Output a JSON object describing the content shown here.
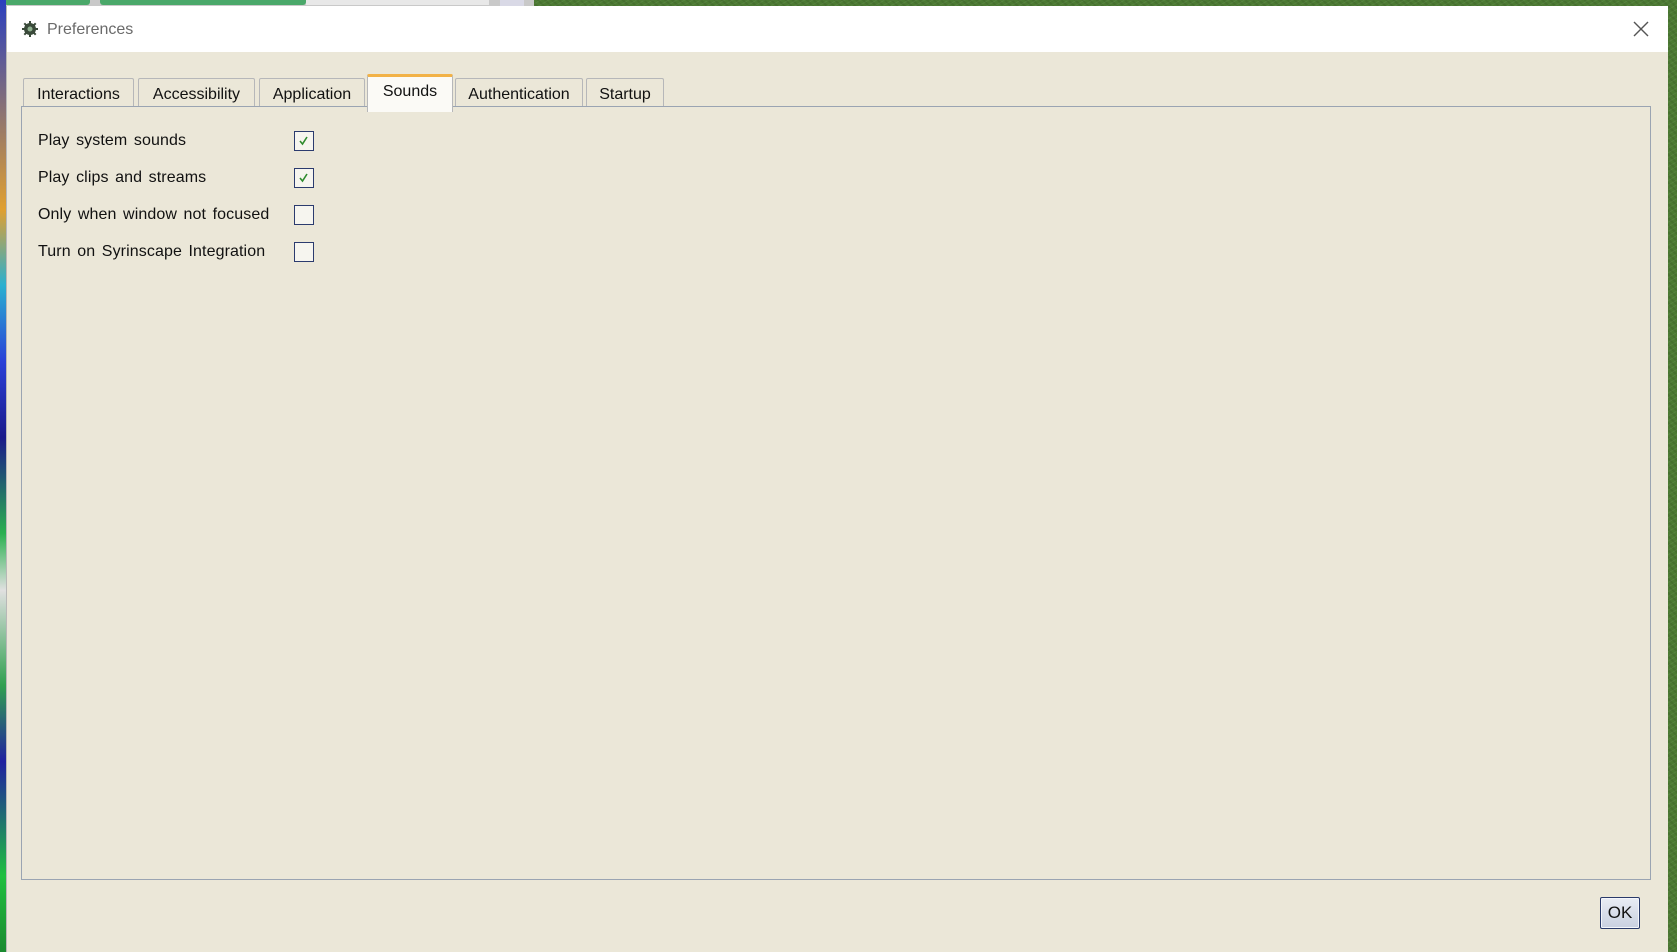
{
  "window": {
    "title": "Preferences"
  },
  "tabs": [
    {
      "label": "Interactions",
      "active": false
    },
    {
      "label": "Accessibility",
      "active": false
    },
    {
      "label": "Application",
      "active": false
    },
    {
      "label": "Sounds",
      "active": true
    },
    {
      "label": "Authentication",
      "active": false
    },
    {
      "label": "Startup",
      "active": false
    }
  ],
  "sounds": {
    "options": [
      {
        "label": "Play system sounds",
        "checked": true
      },
      {
        "label": "Play clips and streams",
        "checked": true
      },
      {
        "label": "Only when window not focused",
        "checked": false
      },
      {
        "label": "Turn on Syrinscape Integration",
        "checked": false
      }
    ]
  },
  "footer": {
    "ok_label": "OK"
  },
  "colors": {
    "dialog_bg": "#ebe7d8",
    "active_tab_accent": "#f2b247",
    "checkbox_border": "#2b3b6e",
    "checkmark": "#2e8b2e"
  }
}
